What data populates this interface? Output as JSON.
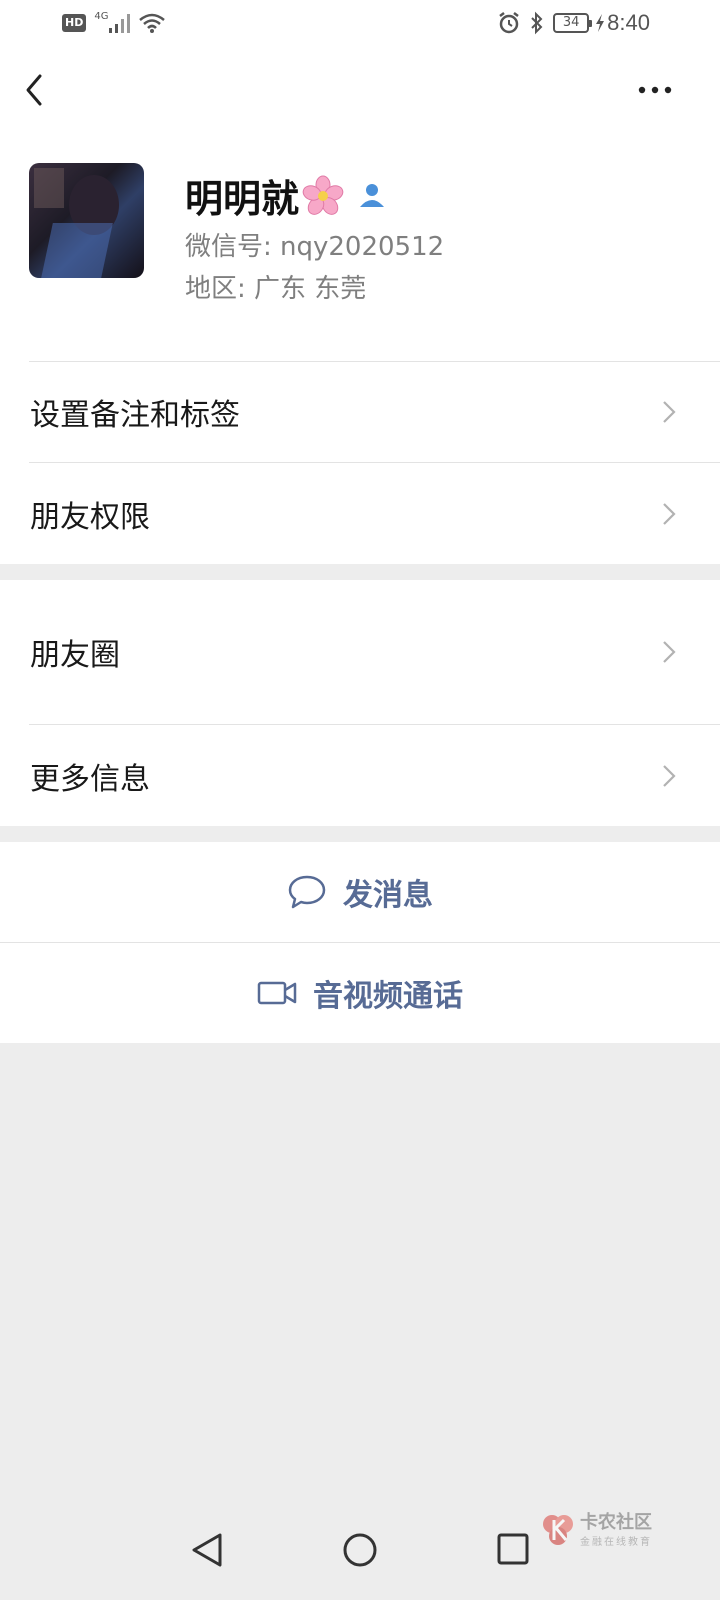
{
  "status_bar": {
    "hd": "HD",
    "network": "4G",
    "battery": "34",
    "time": "8:40"
  },
  "profile": {
    "nickname": "明明就",
    "wechat_id": "微信号: nqy2020512",
    "region": "地区: 广东  东莞"
  },
  "menu_group_1": [
    {
      "label": "设置备注和标签"
    },
    {
      "label": "朋友权限"
    }
  ],
  "menu_group_2": [
    {
      "label": "朋友圈"
    },
    {
      "label": "更多信息"
    }
  ],
  "actions": {
    "send_message": "发消息",
    "video_call": "音视频通话"
  },
  "watermark": {
    "title": "卡农社区",
    "subtitle": "金融在线教育"
  },
  "colors": {
    "link_blue": "#576b95",
    "background": "#ededed",
    "person_badge": "#4a90d9"
  },
  "icons": [
    "back-arrow-icon",
    "more-dots-icon",
    "flower-icon",
    "person-badge-icon",
    "chevron-right-icon",
    "chat-bubble-icon",
    "video-camera-icon"
  ]
}
